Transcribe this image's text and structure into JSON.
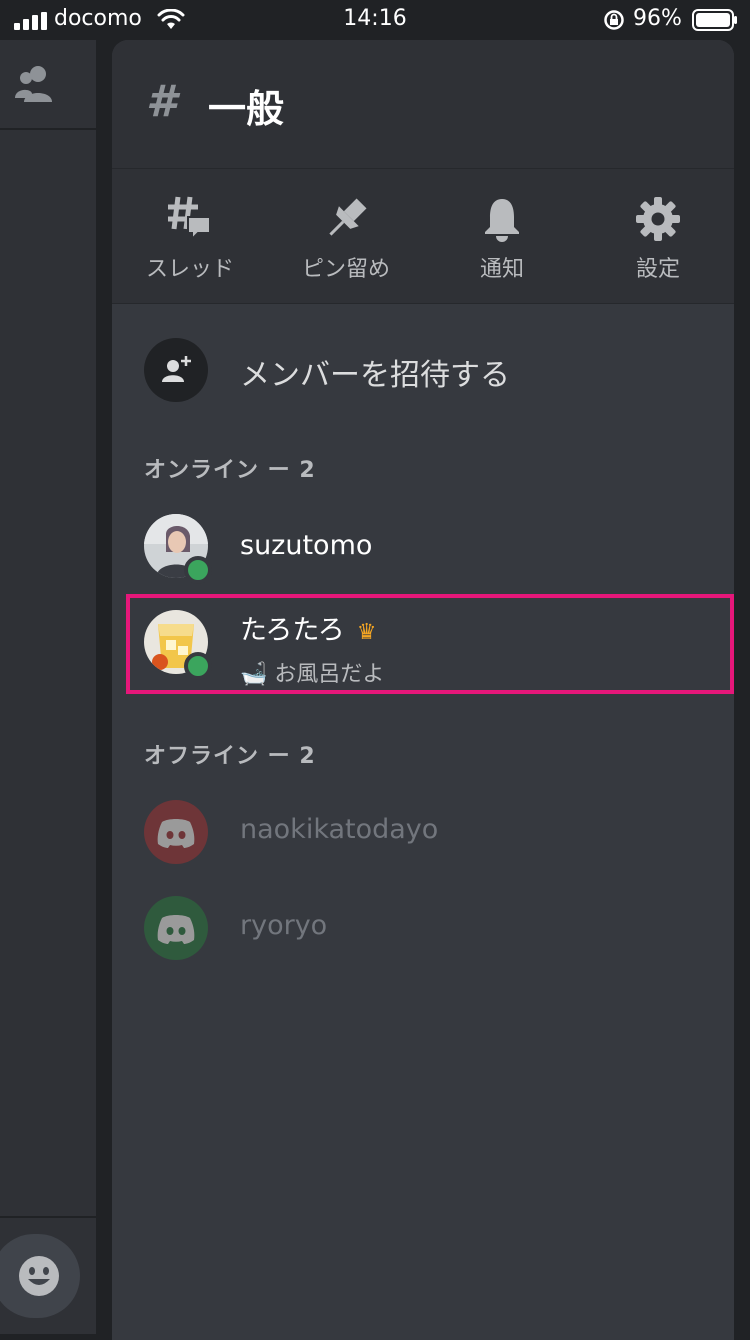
{
  "status_bar": {
    "carrier": "docomo",
    "time": "14:16",
    "battery": "96%"
  },
  "channel": {
    "hash": "#",
    "name": "一般"
  },
  "toolbar": [
    {
      "label": "スレッド",
      "icon": "threads-icon"
    },
    {
      "label": "ピン留め",
      "icon": "pin-icon"
    },
    {
      "label": "通知",
      "icon": "bell-icon"
    },
    {
      "label": "設定",
      "icon": "gear-icon"
    }
  ],
  "invite": {
    "label": "メンバーを招待する",
    "icon": "add-user-icon"
  },
  "online": {
    "header": "オンライン ー 2",
    "members": [
      {
        "name": "suzutomo"
      },
      {
        "name": "たろたろ",
        "badge": "crown",
        "activity_emoji": "🛁",
        "activity": "お風呂だよ"
      }
    ]
  },
  "offline": {
    "header": "オフライン ー 2",
    "members": [
      {
        "name": "naokikatodayo",
        "avatar_color": "#a03c3c"
      },
      {
        "name": "ryoryo",
        "avatar_color": "#3a7a4a"
      }
    ]
  },
  "colors": {
    "online": "#3ba55d",
    "highlight": "#e6177a",
    "crown": "#f5a623"
  }
}
